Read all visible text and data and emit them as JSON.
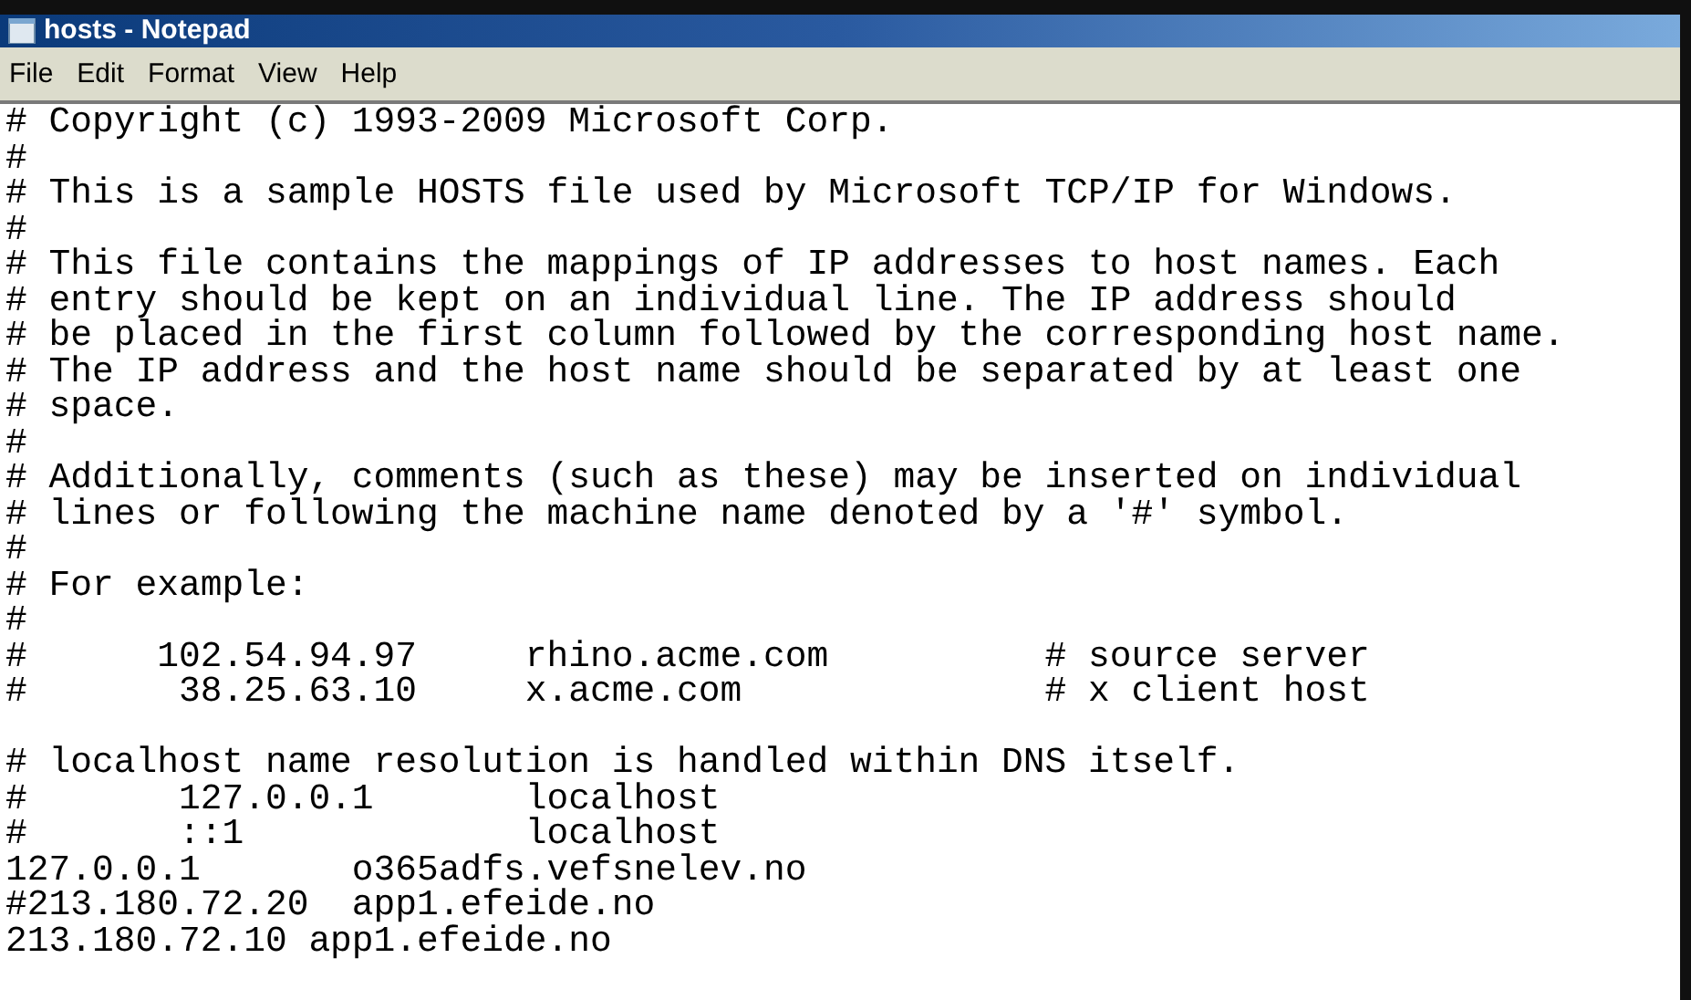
{
  "window": {
    "title": "hosts - Notepad"
  },
  "menu": [
    "File",
    "Edit",
    "Format",
    "View",
    "Help"
  ],
  "blocks": [
    [
      "# Copyright (c) 1993-2009 Microsoft Corp.",
      "#",
      "# This is a sample HOSTS file used by Microsoft TCP/IP for Windows.",
      "#",
      "# This file contains the mappings of IP addresses to host names. Each",
      "# entry should be kept on an individual line. The IP address should",
      "# be placed in the first column followed by the corresponding host name.",
      "# The IP address and the host name should be separated by at least one",
      "# space.",
      "#",
      "# Additionally, comments (such as these) may be inserted on individual",
      "# lines or following the machine name denoted by a '#' symbol.",
      "#",
      "# For example:",
      "#",
      "#      102.54.94.97     rhino.acme.com          # source server",
      "#       38.25.63.10     x.acme.com              # x client host"
    ],
    [
      "# localhost name resolution is handled within DNS itself.",
      "#       127.0.0.1       localhost",
      "#       ::1             localhost",
      "127.0.0.1       o365adfs.vefsnelev.no",
      "#213.180.72.20  app1.efeide.no",
      "213.180.72.10 app1.efeide.no"
    ]
  ]
}
